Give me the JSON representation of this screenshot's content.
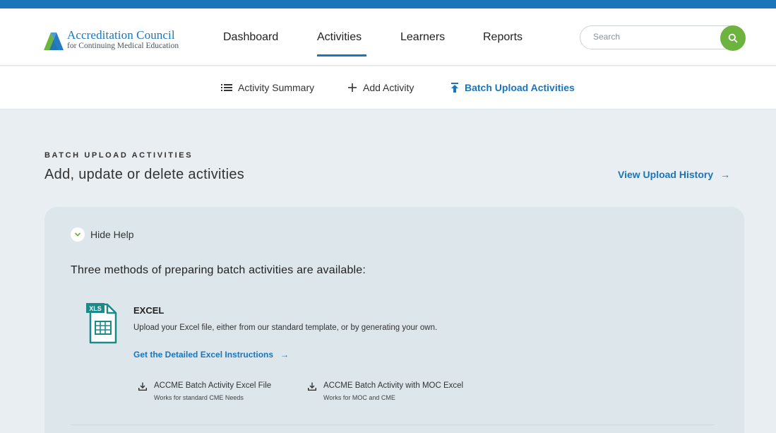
{
  "logo": {
    "title": "Accreditation Council",
    "subtitle": "for Continuing Medical Education",
    "colors": {
      "green": "#6cb33f",
      "blue": "#1b75bb"
    }
  },
  "nav": {
    "items": [
      "Dashboard",
      "Activities",
      "Learners",
      "Reports"
    ],
    "active": "Activities"
  },
  "search": {
    "placeholder": "Search",
    "icon": "search-icon"
  },
  "subnav": {
    "items": [
      {
        "label": "Activity Summary",
        "icon": "list-icon"
      },
      {
        "label": "Add Activity",
        "icon": "plus-icon"
      },
      {
        "label": "Batch Upload Activities",
        "icon": "upload-icon"
      }
    ],
    "active": "Batch Upload Activities"
  },
  "page": {
    "eyebrow": "BATCH UPLOAD ACTIVITIES",
    "title": "Add, update or delete activities",
    "history_link": "View Upload History",
    "history_arrow": "→"
  },
  "help": {
    "toggle_label": "Hide Help",
    "intro": "Three methods of preparing batch activities are available:",
    "excel": {
      "icon_label": "XLS",
      "title": "EXCEL",
      "description": "Upload your Excel file, either from our standard template, or by generating your own.",
      "link": "Get the Detailed Excel Instructions",
      "link_arrow": "→",
      "downloads": [
        {
          "title": "ACCME Batch Activity Excel File",
          "subtitle": "Works for standard CME Needs"
        },
        {
          "title": "ACCME Batch Activity with MOC Excel",
          "subtitle": "Works for MOC and CME"
        }
      ]
    }
  },
  "colors": {
    "accent": "#1b75bb",
    "search_button": "#6cb33f",
    "background": "#e9eef2",
    "card": "#dde6eb",
    "excel_icon": "#1a8a8a"
  }
}
